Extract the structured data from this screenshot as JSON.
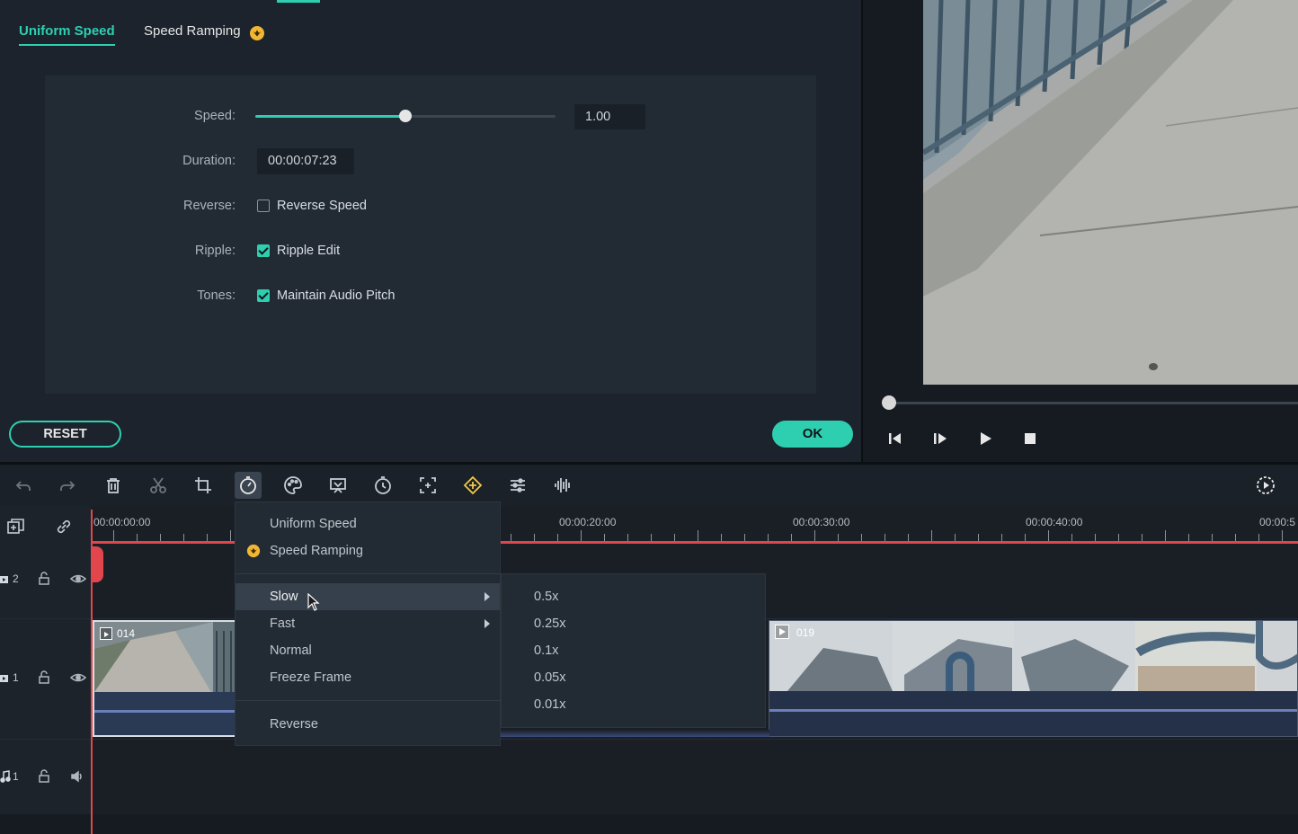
{
  "speed_panel": {
    "tabs": [
      {
        "label": "Uniform Speed"
      },
      {
        "label": "Speed Ramping"
      }
    ],
    "rows": {
      "speed_label": "Speed:",
      "speed_value": "1.00",
      "speed_slider_level": 0.5,
      "duration_label": "Duration:",
      "duration_value": "00:00:07:23",
      "reverse_label": "Reverse:",
      "reverse_option": "Reverse Speed",
      "reverse_checked": false,
      "ripple_label": "Ripple:",
      "ripple_option": "Ripple Edit",
      "ripple_checked": true,
      "tones_label": "Tones:",
      "tones_option": "Maintain Audio Pitch",
      "tones_checked": true
    },
    "reset_label": "RESET",
    "ok_label": "OK"
  },
  "colors": {
    "accent": "#2ecfb0",
    "playhead": "#e0464b",
    "premium": "#f2b632"
  },
  "preview": {
    "controls": [
      "prev-frame-icon",
      "next-frame-icon",
      "play-icon",
      "stop-icon"
    ]
  },
  "toolbar": {
    "tools": [
      "undo-icon",
      "redo-icon",
      "delete-icon",
      "cut-icon",
      "crop-icon",
      "speed-icon",
      "color-icon",
      "stabilize-icon",
      "duration-icon",
      "focus-icon",
      "keyframe-icon",
      "adjust-icon",
      "audio-icon"
    ],
    "render_icon": "render-preview-icon"
  },
  "timeline": {
    "ruler_labels": [
      "00:00:00:00",
      "00:00:20:00",
      "00:00:30:00",
      "00:00:40:00",
      "00:00:5"
    ],
    "tracks": [
      {
        "label": "2",
        "type": "video"
      },
      {
        "label": "1",
        "type": "video"
      },
      {
        "label": "1",
        "type": "audio"
      }
    ],
    "clips": [
      {
        "name": "014"
      },
      {
        "name": "019"
      }
    ]
  },
  "context_menu": {
    "items": [
      {
        "label": "Uniform Speed"
      },
      {
        "label": "Speed Ramping"
      },
      {
        "label": "Slow"
      },
      {
        "label": "Fast"
      },
      {
        "label": "Normal"
      },
      {
        "label": "Freeze Frame"
      },
      {
        "label": "Reverse"
      }
    ],
    "submenu": [
      "0.5x",
      "0.25x",
      "0.1x",
      "0.05x",
      "0.01x"
    ]
  }
}
